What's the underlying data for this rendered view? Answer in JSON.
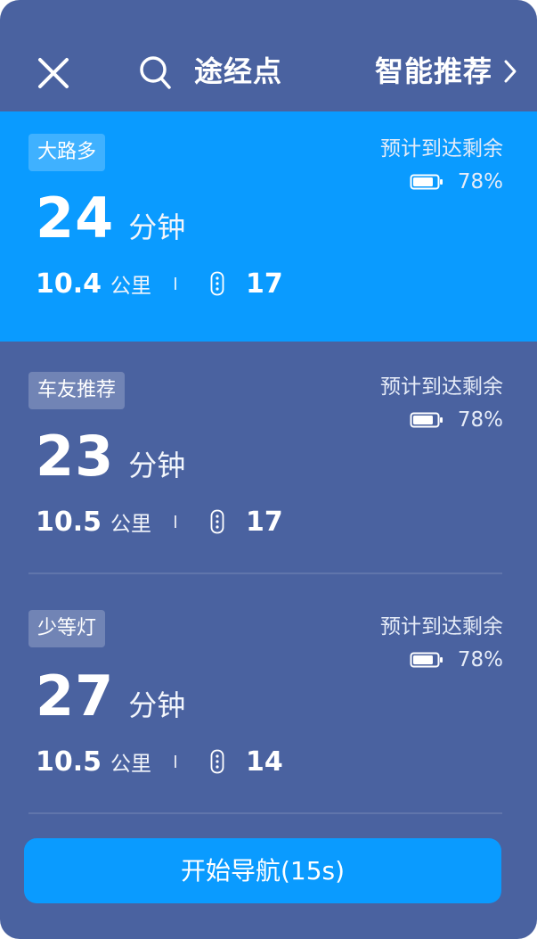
{
  "header": {
    "close_icon": "close-icon",
    "search_icon": "search-icon",
    "waypoint_label": "途经点",
    "recommend_label": "智能推荐",
    "recommend_icon": "chevron-right-icon"
  },
  "routes": [
    {
      "tag": "大路多",
      "arrive_label": "预计到达剩余",
      "battery_pct": "78%",
      "battery_level": 0.78,
      "time_value": "24",
      "time_unit": "分钟",
      "distance_value": "10.4",
      "distance_unit": "公里",
      "traffic_lights": "17",
      "selected": true
    },
    {
      "tag": "车友推荐",
      "arrive_label": "预计到达剩余",
      "battery_pct": "78%",
      "battery_level": 0.78,
      "time_value": "23",
      "time_unit": "分钟",
      "distance_value": "10.5",
      "distance_unit": "公里",
      "traffic_lights": "17",
      "selected": false
    },
    {
      "tag": "少等灯",
      "arrive_label": "预计到达剩余",
      "battery_pct": "78%",
      "battery_level": 0.78,
      "time_value": "27",
      "time_unit": "分钟",
      "distance_value": "10.5",
      "distance_unit": "公里",
      "traffic_lights": "14",
      "selected": false
    }
  ],
  "start_button": {
    "label": "开始导航(15s)"
  },
  "colors": {
    "panel_bg": "#4a62a0",
    "accent": "#0a9bff",
    "text": "#ffffff"
  }
}
